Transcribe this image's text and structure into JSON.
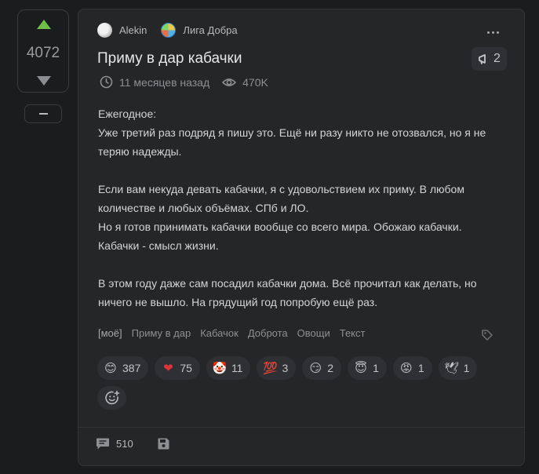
{
  "vote": {
    "count": "4072"
  },
  "post": {
    "author": "Alekin",
    "community": "Лига Добра",
    "title": "Приму в дар кабачки",
    "reposts": "2",
    "time": "11 месяцев назад",
    "views": "470K",
    "body": [
      "Ежегодное:",
      "Уже третий раз подряд я пишу это. Ещё ни разу никто не отозвался, но я не теряю надежды.",
      "",
      "Если вам некуда девать кабачки, я с удовольствием их приму. В любом количестве и любых объёмах. СПб и ЛО.",
      "Но я готов принимать кабачки вообще со всего мира. Обожаю кабачки. Кабачки - смысл жизни.",
      "",
      "В этом году даже сам посадил кабачки дома. Всё прочитал как делать, но ничего не вышло. На грядущий год попробую ещё раз."
    ],
    "tags": [
      "[моё]",
      "Приму в дар",
      "Кабачок",
      "Доброта",
      "Овощи",
      "Текст"
    ],
    "reactions": [
      {
        "emoji": "😊",
        "count": "387"
      },
      {
        "emoji": "❤",
        "count": "75"
      },
      {
        "emoji": "🤡",
        "count": "11"
      },
      {
        "emoji": "💯",
        "count": "3"
      },
      {
        "emoji": "😏",
        "count": "2"
      },
      {
        "emoji": "😇",
        "count": "1"
      },
      {
        "emoji": "😡",
        "count": "1"
      },
      {
        "emoji": "🕊",
        "count": "1"
      }
    ],
    "comments": "510"
  },
  "colors": {
    "upvote": "#6fbf4a",
    "background": "#1b1c1e",
    "card": "#252628",
    "chip": "#2f3033"
  }
}
